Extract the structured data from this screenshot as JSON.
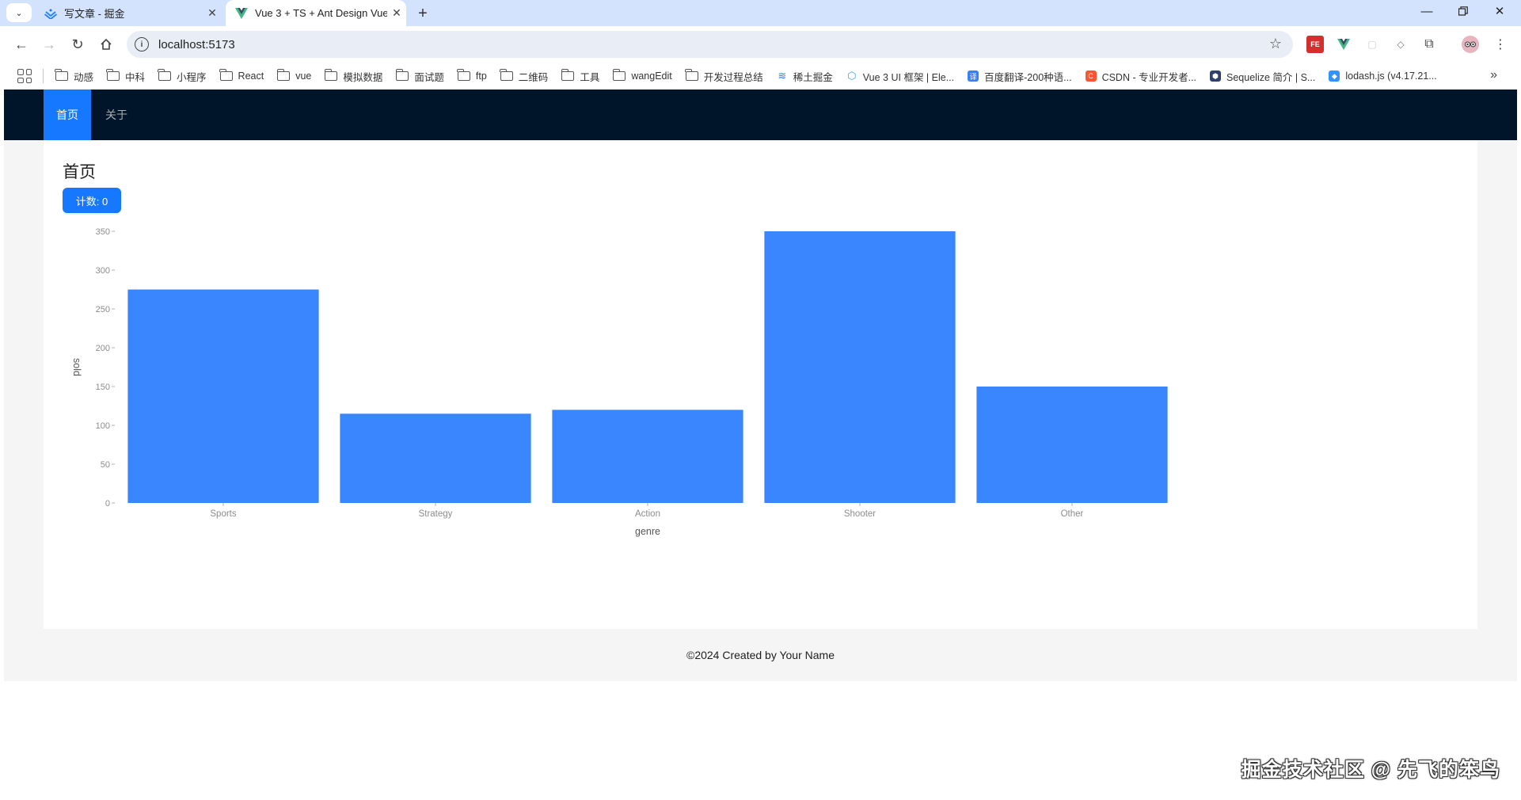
{
  "browser": {
    "tabs": [
      {
        "title": "写文章 - 掘金",
        "active": false,
        "icon": "juejin-icon"
      },
      {
        "title": "Vue 3 + TS + Ant Design Vue",
        "active": true,
        "icon": "vue-icon"
      }
    ],
    "url": "localhost:5173",
    "bookmarks": [
      {
        "label": "动感",
        "icon": "folder-icon"
      },
      {
        "label": "中科",
        "icon": "folder-icon"
      },
      {
        "label": "小程序",
        "icon": "folder-icon"
      },
      {
        "label": "React",
        "icon": "folder-icon"
      },
      {
        "label": "vue",
        "icon": "folder-icon"
      },
      {
        "label": "模拟数据",
        "icon": "folder-icon"
      },
      {
        "label": "面试题",
        "icon": "folder-icon"
      },
      {
        "label": "ftp",
        "icon": "folder-icon"
      },
      {
        "label": "二维码",
        "icon": "folder-icon"
      },
      {
        "label": "工具",
        "icon": "folder-icon"
      },
      {
        "label": "wangEdit",
        "icon": "folder-icon"
      },
      {
        "label": "开发过程总结",
        "icon": "folder-icon"
      },
      {
        "label": "稀土掘金",
        "icon": "juejin-icon"
      },
      {
        "label": "Vue 3 UI 框架 | Ele...",
        "icon": "element-icon"
      },
      {
        "label": "百度翻译-200种语...",
        "icon": "baidu-translate-icon"
      },
      {
        "label": "CSDN - 专业开发者...",
        "icon": "csdn-icon"
      },
      {
        "label": "Sequelize 简介 | S...",
        "icon": "sequelize-icon"
      },
      {
        "label": "lodash.js (v4.17.21...",
        "icon": "lodash-icon"
      }
    ]
  },
  "app": {
    "menu": [
      {
        "label": "首页",
        "selected": true
      },
      {
        "label": "关于",
        "selected": false
      }
    ],
    "page_title": "首页",
    "count_button": "计数: 0",
    "footer": "©2024 Created by Your Name"
  },
  "chart_data": {
    "type": "bar",
    "categories": [
      "Sports",
      "Strategy",
      "Action",
      "Shooter",
      "Other"
    ],
    "values": [
      275,
      115,
      120,
      350,
      150
    ],
    "xlabel": "genre",
    "ylabel": "sold",
    "ylim": [
      0,
      350
    ],
    "yticks": [
      0,
      50,
      100,
      150,
      200,
      250,
      300,
      350
    ],
    "bar_color": "#3a86ff",
    "grid": false
  },
  "watermark": "掘金技术社区 @ 先飞的笨鸟",
  "colors": {
    "header_bg": "#001529",
    "primary": "#1677ff",
    "tabstrip_bg": "#d3e3fd"
  }
}
